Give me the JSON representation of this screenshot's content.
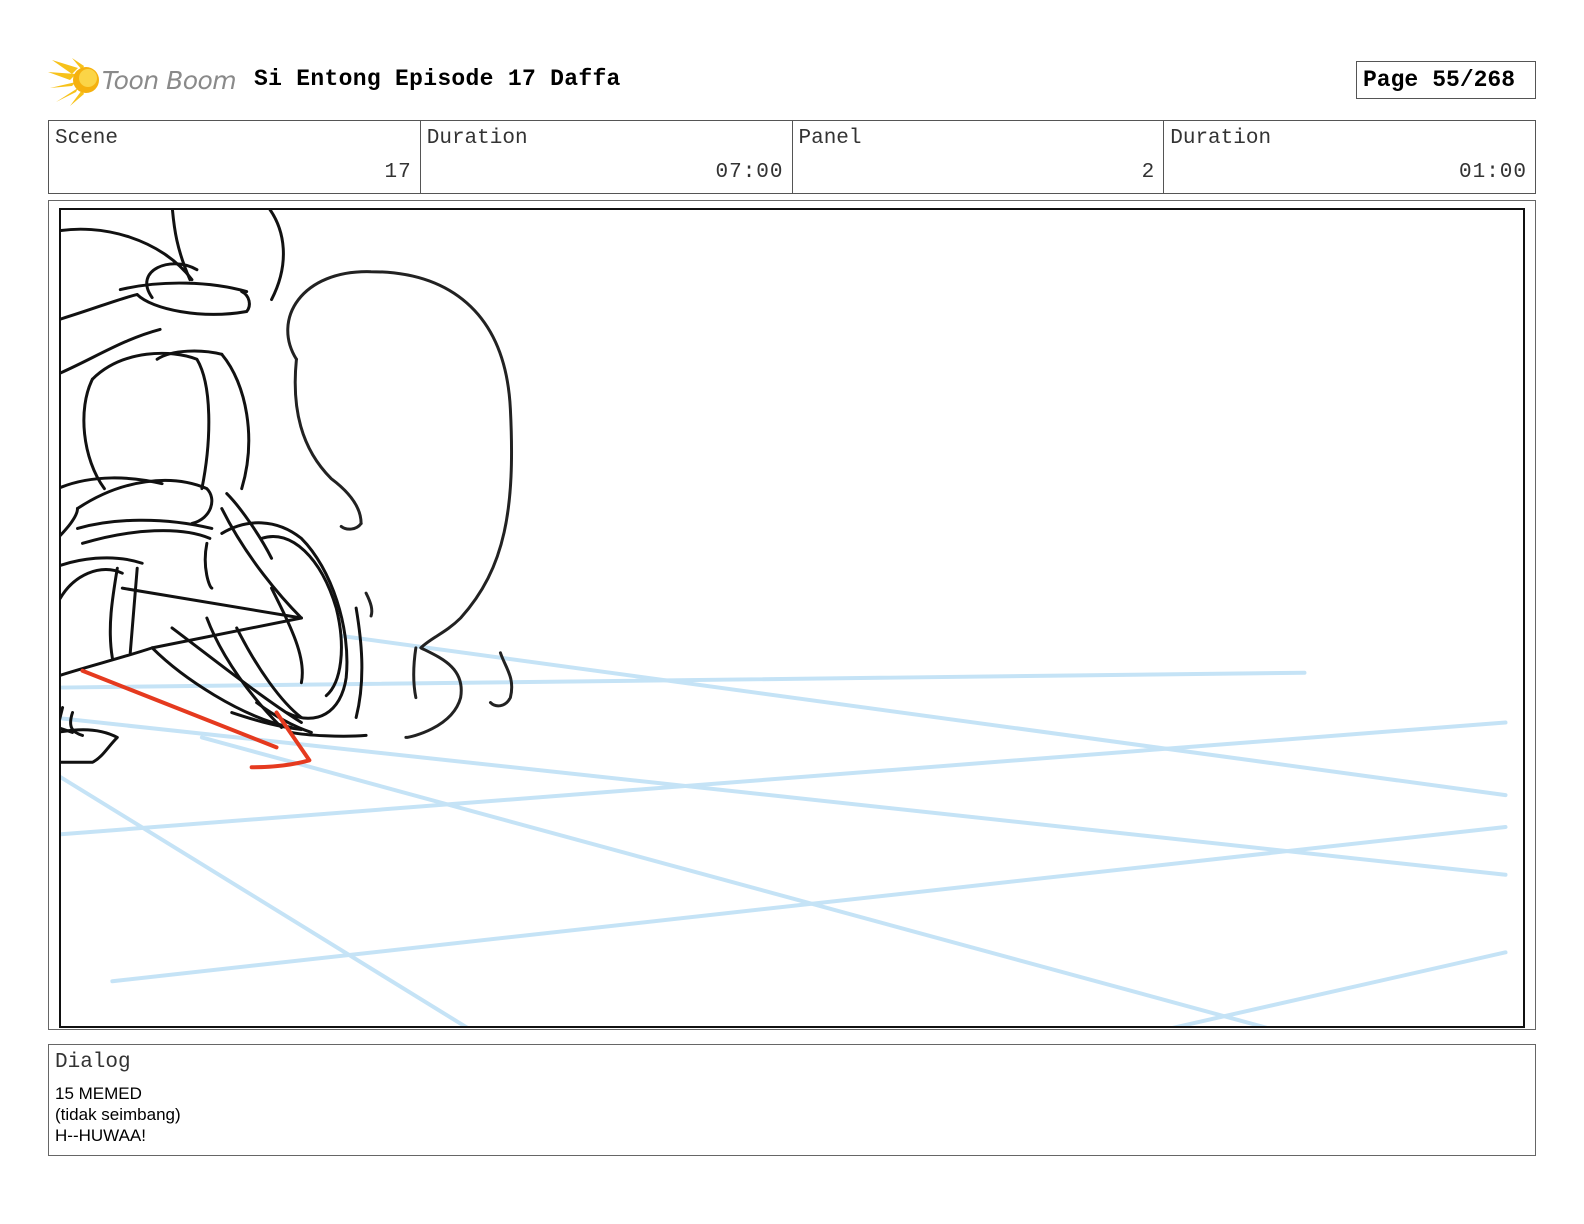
{
  "header": {
    "logo_text": "Toon Boom",
    "title": "Si Entong Episode 17 Daffa",
    "page_label": "Page",
    "page_value": "55/268"
  },
  "info": [
    {
      "label": "Scene",
      "value": "17"
    },
    {
      "label": "Duration",
      "value": "07:00"
    },
    {
      "label": "Panel",
      "value": "2"
    },
    {
      "label": "Duration",
      "value": "01:00"
    }
  ],
  "dialog": {
    "label": "Dialog",
    "lines": [
      "15 MEMED",
      "(tidak seimbang)",
      "H--HUWAA!"
    ]
  },
  "colors": {
    "guide_lines": "#c5e3f6",
    "sketch": "#111111",
    "action_arrow": "#e53a1f",
    "logo_sun": "#f7c21a"
  }
}
